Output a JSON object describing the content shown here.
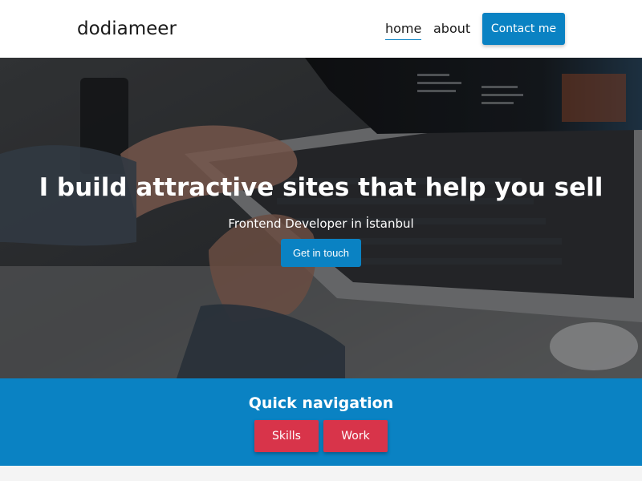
{
  "header": {
    "brand": "dodiameer",
    "nav": {
      "home": "home",
      "about": "about"
    },
    "contact_label": "Contact me"
  },
  "hero": {
    "title": "I build attractive sites that help you sell",
    "subtitle": "Frontend Developer in İstanbul",
    "cta_label": "Get in touch"
  },
  "quick_nav": {
    "title": "Quick navigation",
    "buttons": [
      {
        "label": "Skills"
      },
      {
        "label": "Work"
      }
    ]
  },
  "colors": {
    "accent": "#0a82c3",
    "button_red": "#d8344a",
    "header_bg": "#ffffff"
  }
}
